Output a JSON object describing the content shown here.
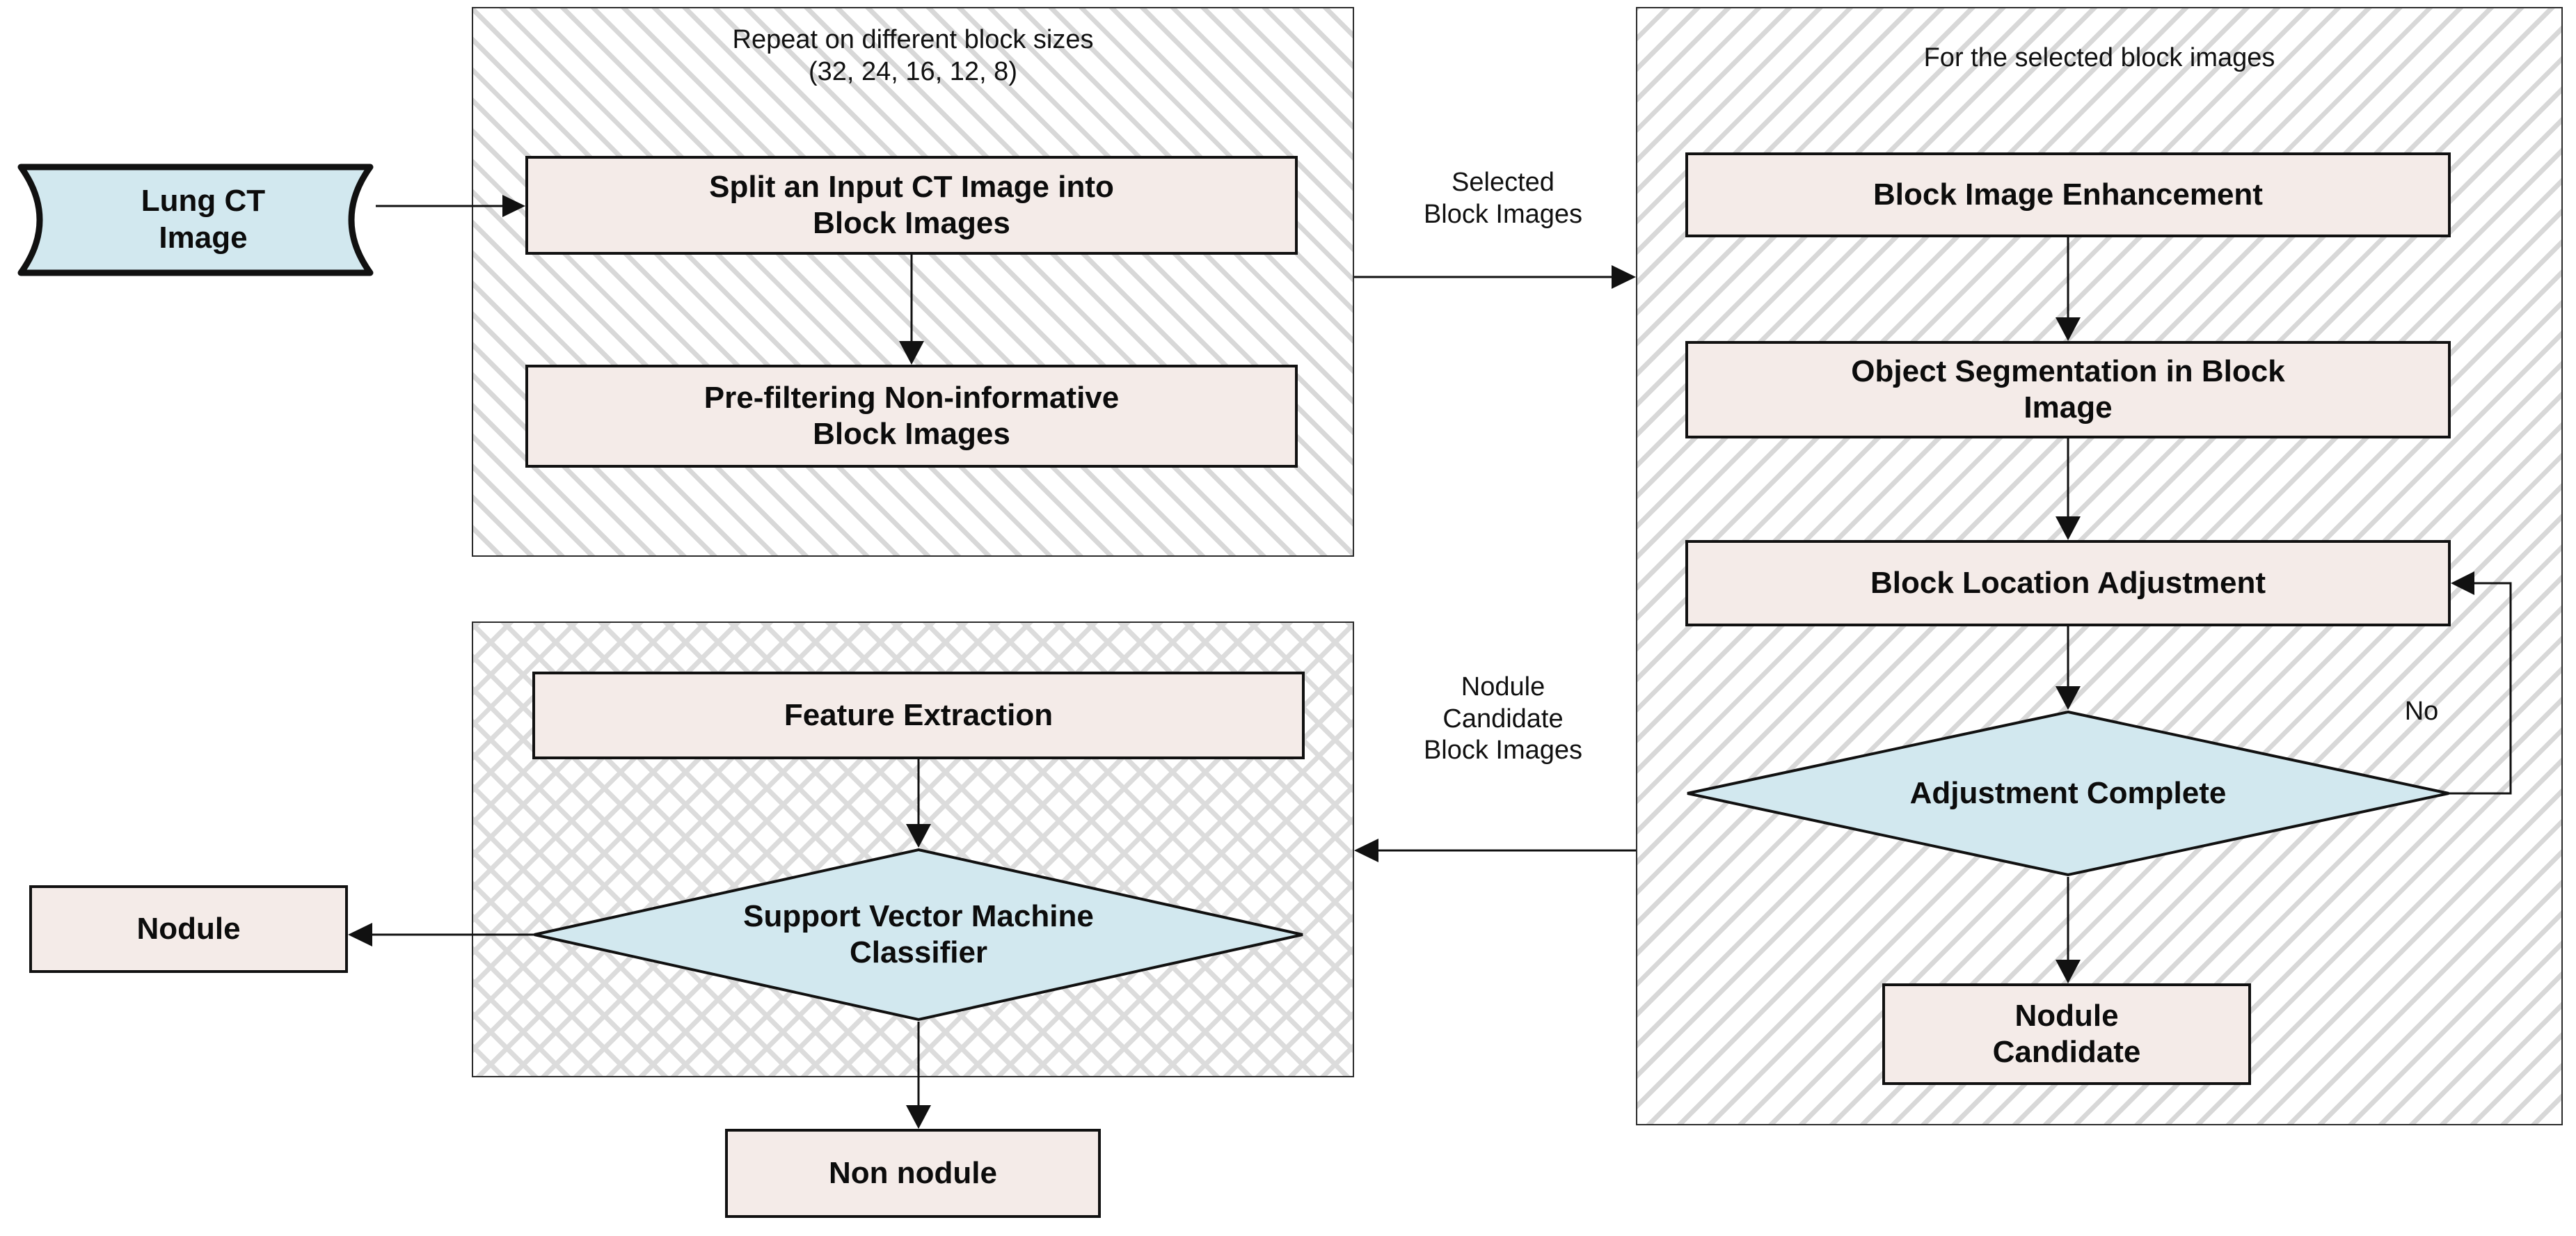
{
  "diagram": {
    "title": "Lung nodule detection pipeline flowchart",
    "colors": {
      "process_fill": "#f4ebe8",
      "decision_fill": "#d2e8ef",
      "data_fill": "#d2e8ef",
      "stroke": "#111111",
      "hatch": "#d8d8d8",
      "background": "#ffffff"
    }
  },
  "groups": {
    "block_split": {
      "caption": "Repeat on different block sizes\n(32, 24, 16, 12, 8)"
    },
    "classification": {
      "caption": ""
    },
    "block_processing": {
      "caption": "For the selected block images"
    }
  },
  "nodes": {
    "lung_ct_image": {
      "label": "Lung CT\nImage"
    },
    "split_input": {
      "label": "Split an Input CT Image into\nBlock Images"
    },
    "prefilter": {
      "label": "Pre-filtering Non-informative\nBlock Images"
    },
    "block_enhancement": {
      "label": "Block Image Enhancement"
    },
    "object_segmentation": {
      "label": "Object Segmentation in Block\nImage"
    },
    "block_location_adjustment": {
      "label": "Block Location Adjustment"
    },
    "adjustment_complete": {
      "label": "Adjustment Complete"
    },
    "nodule_candidate": {
      "label": "Nodule\nCandidate"
    },
    "feature_extraction": {
      "label": "Feature Extraction"
    },
    "svm_classifier": {
      "label": "Support Vector Machine\nClassifier"
    },
    "nodule": {
      "label": "Nodule"
    },
    "non_nodule": {
      "label": "Non nodule"
    }
  },
  "edge_labels": {
    "selected_block_images": "Selected\nBlock Images",
    "nodule_candidate_block_images": "Nodule\nCandidate\nBlock Images",
    "no_branch": "No"
  }
}
